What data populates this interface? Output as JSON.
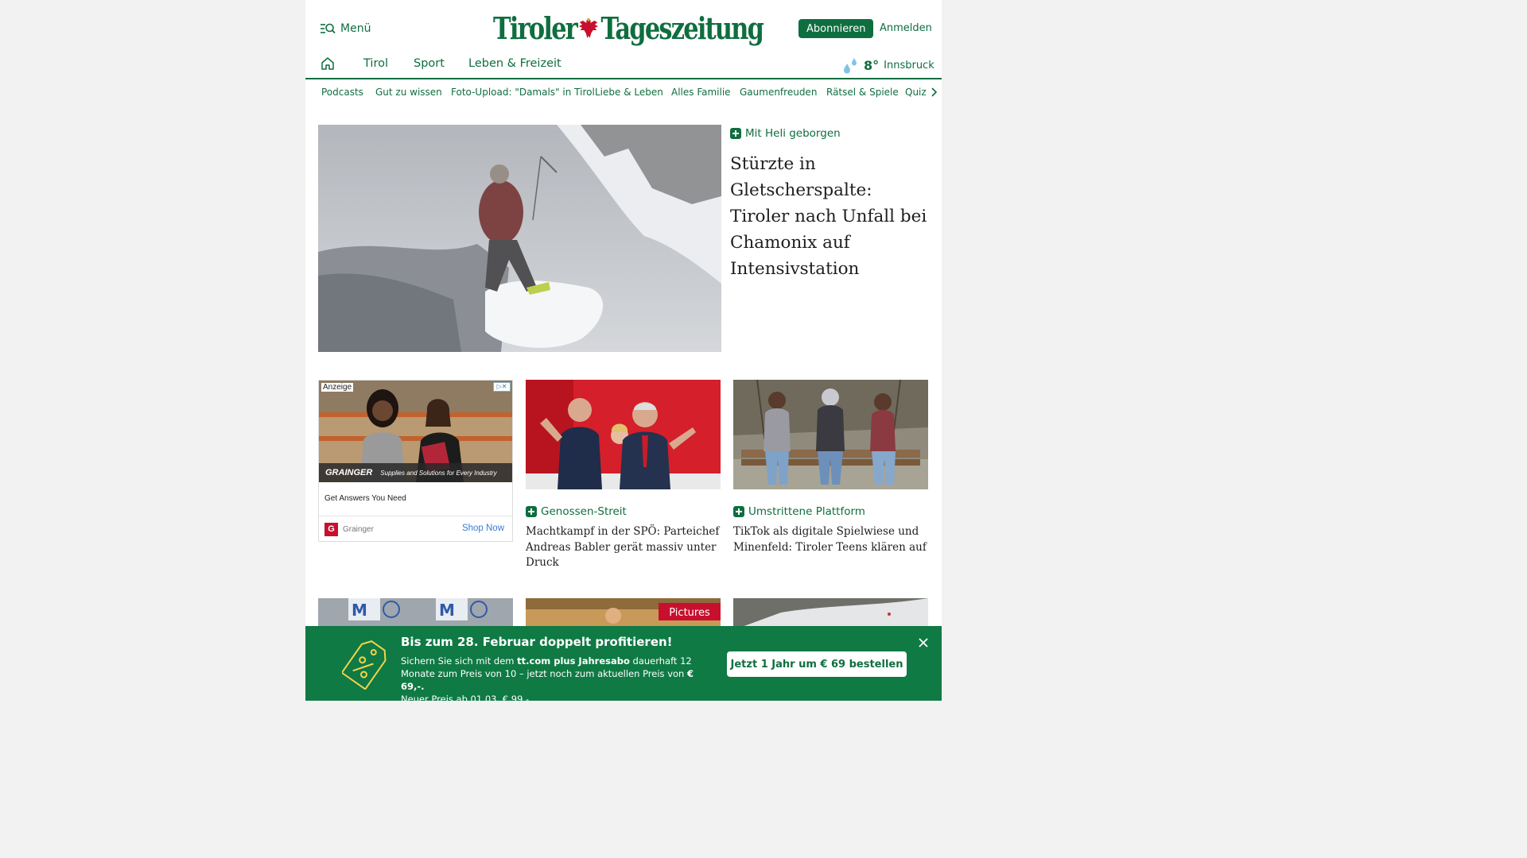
{
  "header": {
    "menu_label": "Menü",
    "logo_text_left": "Tiroler",
    "logo_text_right": "Tageszeitung",
    "subscribe_label": "Abonnieren",
    "login_label": "Anmelden"
  },
  "mainnav": {
    "items": [
      {
        "label": "Tirol"
      },
      {
        "label": "Sport"
      },
      {
        "label": "Leben & Freizeit"
      }
    ],
    "weather": {
      "temperature": "8°",
      "city": "Innsbruck",
      "icon": "rain-drops-icon"
    }
  },
  "subnav": {
    "items": [
      {
        "label": "Podcasts"
      },
      {
        "label": "Gut zu wissen"
      },
      {
        "label": "Foto-Upload: \"Damals\" in Tirol"
      },
      {
        "label": "Liebe & Leben"
      },
      {
        "label": "Alles Familie"
      },
      {
        "label": "Gaumenfreuden"
      },
      {
        "label": "Rätsel & Spiele"
      },
      {
        "label": "Quiz"
      }
    ]
  },
  "hero": {
    "kicker": "Mit Heli geborgen",
    "title": "Stürzte in Gletscherspalte: Tiroler nach Unfall bei Chamonix auf Intensivstation"
  },
  "ad": {
    "label": "Anzeige",
    "brand": "GRAINGER",
    "tagline": "Supplies and Solutions for Every Industry",
    "headline": "Get Answers You Need",
    "advertiser": "Grainger",
    "cta": "Shop Now"
  },
  "articles": [
    {
      "kicker": "Genossen-Streit",
      "title": "Machtkampf in der SPÖ: Parteichef Andreas Babler gerät massiv unter Druck"
    },
    {
      "kicker": "Umstrittene Plattform",
      "title": "TikTok als digitale Spielwiese und Minenfeld: Tiroler Teens klären auf"
    }
  ],
  "row3": {
    "middle_badge": "Pictures"
  },
  "promo": {
    "title": "Bis zum 28. Februar doppelt profitieren!",
    "text_1": "Sichern Sie sich mit dem ",
    "text_bold_1": "tt.com plus Jahresabo",
    "text_2": " dauerhaft 12 Monate zum Preis von 10 – jetzt noch zum aktuellen Preis von ",
    "text_bold_2": "€ 69,-.",
    "text_3": "Neuer Preis ab 01.03. € 99,-",
    "button": "Jetzt 1 Jahr um € 69 bestellen"
  },
  "colors": {
    "brand_green": "#0f6e3f",
    "promo_green": "#0f7a44",
    "ad_link": "#3b7bd4"
  }
}
